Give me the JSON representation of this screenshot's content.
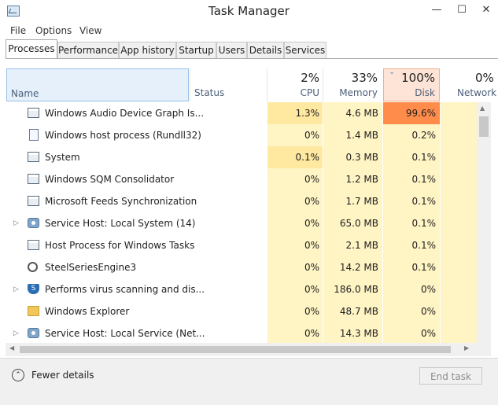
{
  "window": {
    "title": "Task Manager",
    "minimize": "—",
    "maximize": "☐",
    "close": "✕"
  },
  "menu": [
    "File",
    "Options",
    "View"
  ],
  "tabs": [
    "Processes",
    "Performance",
    "App history",
    "Startup",
    "Users",
    "Details",
    "Services"
  ],
  "active_tab": "Processes",
  "columns": {
    "name": "Name",
    "status": "Status",
    "cpu": {
      "pct": "2%",
      "label": "CPU"
    },
    "memory": {
      "pct": "33%",
      "label": "Memory"
    },
    "disk": {
      "pct": "100%",
      "label": "Disk"
    },
    "network": {
      "pct": "0%",
      "label": "Network"
    }
  },
  "sort_indicator": "⌄",
  "processes": [
    {
      "name": "Windows Audio Device Graph Is...",
      "cpu": "1.3%",
      "memory": "4.6 MB",
      "disk": "99.6%",
      "icon": "window-icon",
      "expand": false
    },
    {
      "name": "Windows host process (Rundll32)",
      "cpu": "0%",
      "memory": "1.4 MB",
      "disk": "0.2%",
      "icon": "document-icon",
      "expand": false
    },
    {
      "name": "System",
      "cpu": "0.1%",
      "memory": "0.3 MB",
      "disk": "0.1%",
      "icon": "window-icon",
      "expand": false
    },
    {
      "name": "Windows SQM Consolidator",
      "cpu": "0%",
      "memory": "1.2 MB",
      "disk": "0.1%",
      "icon": "window-icon",
      "expand": false
    },
    {
      "name": "Microsoft Feeds Synchronization",
      "cpu": "0%",
      "memory": "1.7 MB",
      "disk": "0.1%",
      "icon": "window-icon",
      "expand": false
    },
    {
      "name": "Service Host: Local System (14)",
      "cpu": "0%",
      "memory": "65.0 MB",
      "disk": "0.1%",
      "icon": "gear-icon",
      "expand": true
    },
    {
      "name": "Host Process for Windows Tasks",
      "cpu": "0%",
      "memory": "2.1 MB",
      "disk": "0.1%",
      "icon": "window-icon",
      "expand": false
    },
    {
      "name": "SteelSeriesEngine3",
      "cpu": "0%",
      "memory": "14.2 MB",
      "disk": "0.1%",
      "icon": "engine-icon",
      "expand": false
    },
    {
      "name": "Performs virus scanning and dis...",
      "cpu": "0%",
      "memory": "186.0 MB",
      "disk": "0%",
      "icon": "shield-icon",
      "expand": true
    },
    {
      "name": "Windows Explorer",
      "cpu": "0%",
      "memory": "48.7 MB",
      "disk": "0%",
      "icon": "folder-icon",
      "expand": false
    },
    {
      "name": "Service Host: Local Service (Net...",
      "cpu": "0%",
      "memory": "14.3 MB",
      "disk": "0%",
      "icon": "gear-icon",
      "expand": true
    }
  ],
  "footer": {
    "fewer_details": "Fewer details",
    "end_task": "End task"
  },
  "colors": {
    "heat_low": "#fff4c4",
    "heat_mid": "#ffe8a0",
    "heat_high": "#ff8c4a",
    "disk_header_bg": "#fde4d6",
    "name_header_bg": "#e5f0fb"
  }
}
